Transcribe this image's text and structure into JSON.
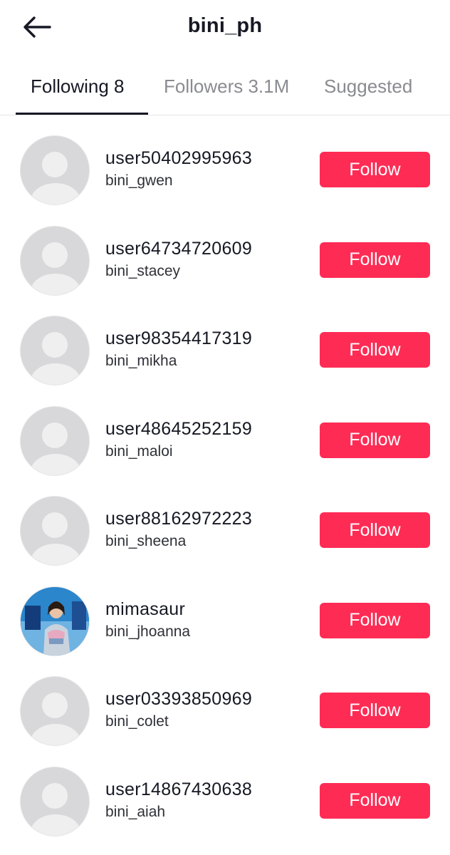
{
  "header": {
    "title": "bini_ph",
    "back_icon": "arrow-left-icon"
  },
  "tabs": [
    {
      "label": "Following 8",
      "active": true
    },
    {
      "label": "Followers 3.1M",
      "active": false
    },
    {
      "label": "Suggested",
      "active": false
    }
  ],
  "accent_color": "#fe2c55",
  "users": [
    {
      "username": "user50402995963",
      "nickname": "bini_gwen",
      "avatar": "default-avatar-icon",
      "button": "Follow"
    },
    {
      "username": "user64734720609",
      "nickname": "bini_stacey",
      "avatar": "default-avatar-icon",
      "button": "Follow"
    },
    {
      "username": "user98354417319",
      "nickname": "bini_mikha",
      "avatar": "default-avatar-icon",
      "button": "Follow"
    },
    {
      "username": "user48645252159",
      "nickname": "bini_maloi",
      "avatar": "default-avatar-icon",
      "button": "Follow"
    },
    {
      "username": "user88162972223",
      "nickname": "bini_sheena",
      "avatar": "default-avatar-icon",
      "button": "Follow"
    },
    {
      "username": "mimasaur",
      "nickname": "bini_jhoanna",
      "avatar": "profile-photo",
      "button": "Follow"
    },
    {
      "username": "user03393850969",
      "nickname": "bini_colet",
      "avatar": "default-avatar-icon",
      "button": "Follow"
    },
    {
      "username": "user14867430638",
      "nickname": "bini_aiah",
      "avatar": "default-avatar-icon",
      "button": "Follow"
    }
  ]
}
